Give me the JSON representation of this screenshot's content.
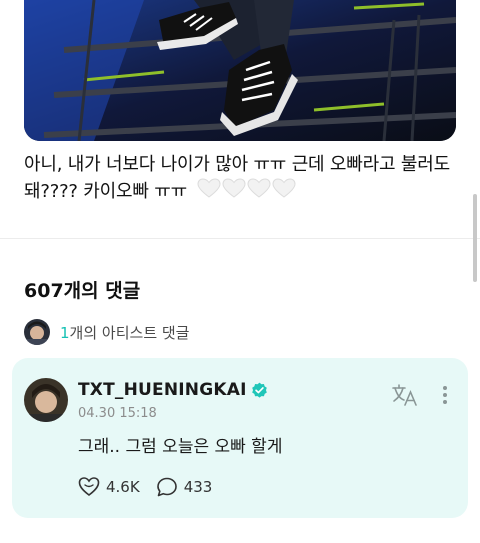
{
  "post": {
    "text_line1": "아니, 내가 너보다 나이가 많아 ㅠㅠ 근데 오빠라고 불러도",
    "text_line2": "돼???? 카이오빠 ㅠㅠ"
  },
  "comments": {
    "count_label": "607개의 댓글",
    "artist_link": {
      "count": "1",
      "label": "개의 아티스트 댓글"
    }
  },
  "artist_comment": {
    "username": "TXT_HUENINGKAI",
    "timestamp": "04.30 15:18",
    "body": "그래.. 그럼 오늘은 오빠 할게",
    "likes": "4.6K",
    "replies": "433"
  },
  "colors": {
    "accent": "#16c1b4",
    "card_bg": "#e7f9f7",
    "verified": "#1fc6b8"
  },
  "icons": [
    "translate-icon",
    "more-vertical-icon",
    "verified-icon",
    "like-icon",
    "reply-icon",
    "white-heart-icon"
  ]
}
